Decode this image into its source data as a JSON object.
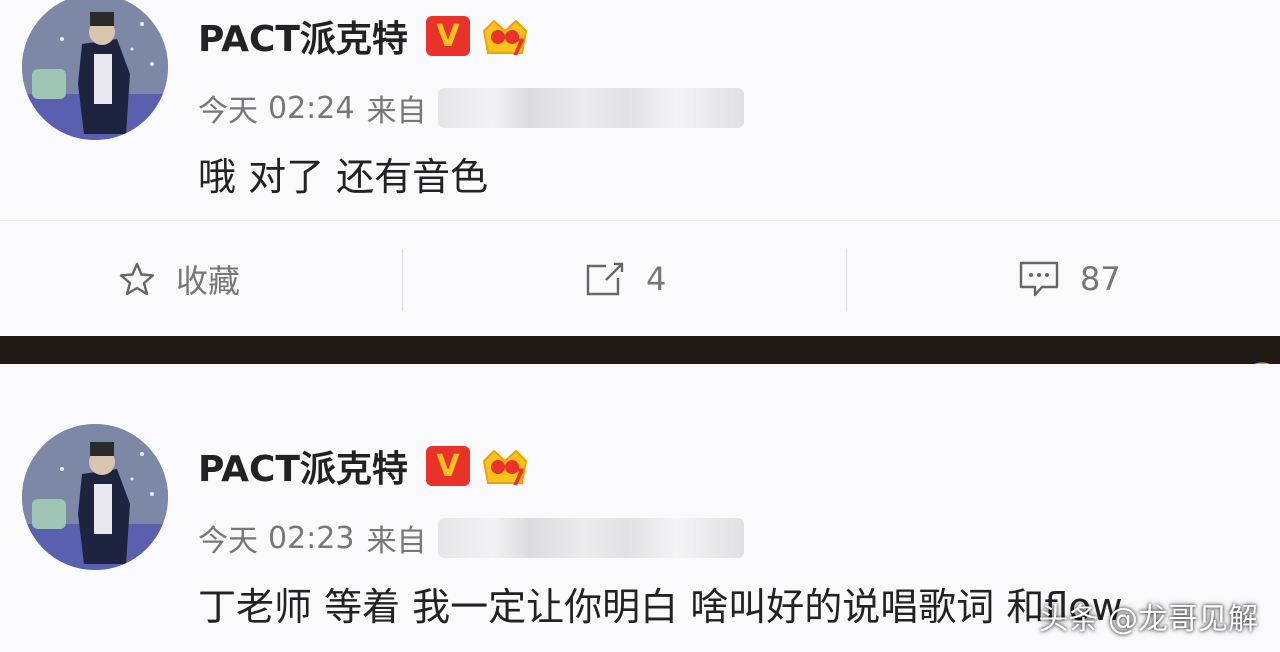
{
  "posts": [
    {
      "username": "PACT派克特",
      "verified_badge": "V",
      "level_badge": "crown-7-icon",
      "time_prefix": "今天",
      "time": "02:24",
      "from_label": "来自",
      "content": "哦 对了 还有音色"
    },
    {
      "username": "PACT派克特",
      "verified_badge": "V",
      "level_badge": "crown-7-icon",
      "time_prefix": "今天",
      "time": "02:23",
      "from_label": "来自",
      "content": "丁老师 等着 我一定让你明白 啥叫好的说唱歌词 和flow"
    }
  ],
  "actions": {
    "favorite_label": "收藏",
    "share_count": "4",
    "comment_count": "87"
  },
  "watermark": "头条 @龙哥见解",
  "colors": {
    "badge_red": "#e9322a",
    "badge_gold": "#ffc21a",
    "text_gray": "#777777",
    "divider_dark": "#201a16"
  }
}
